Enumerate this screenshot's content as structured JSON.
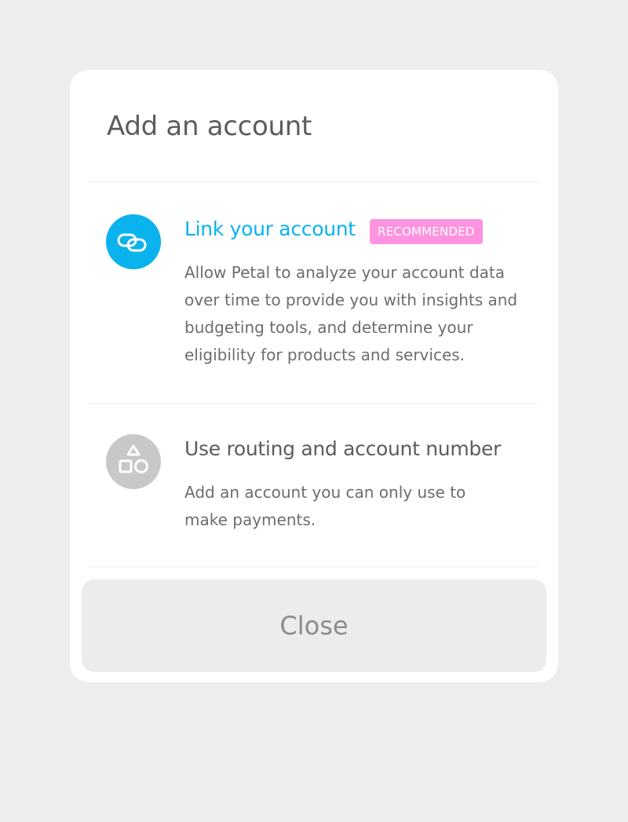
{
  "modal": {
    "title": "Add an account",
    "close_label": "Close"
  },
  "options": [
    {
      "title": "Link your account",
      "badge": "RECOMMENDED",
      "description": "Allow Petal to analyze your account data over time to provide you with insights and budgeting tools, and determine your eligibility for products and services.",
      "icon": "link-rings-icon",
      "accent_color": "#0ab3ee",
      "badge_color": "#fe94e0"
    },
    {
      "title": "Use routing and account number",
      "description": "Add an account you can only use to make payments.",
      "icon": "shapes-icon",
      "accent_color": "#c8c8c8"
    }
  ]
}
